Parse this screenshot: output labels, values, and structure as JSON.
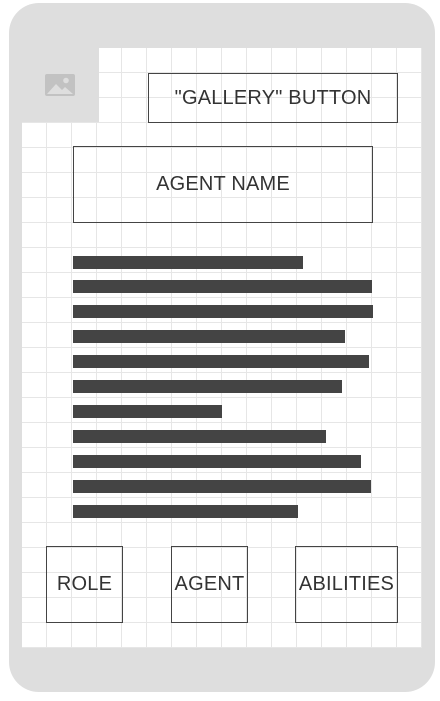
{
  "header": {
    "image_icon": "image-icon",
    "gallery_button_label": "\"GALLERY\" BUTTON"
  },
  "agent": {
    "name_label": "AGENT NAME",
    "description_placeholder_lines": 11
  },
  "tabs": [
    {
      "label": "ROLE"
    },
    {
      "label": "AGENT"
    },
    {
      "label": "ABILITIES"
    }
  ]
}
